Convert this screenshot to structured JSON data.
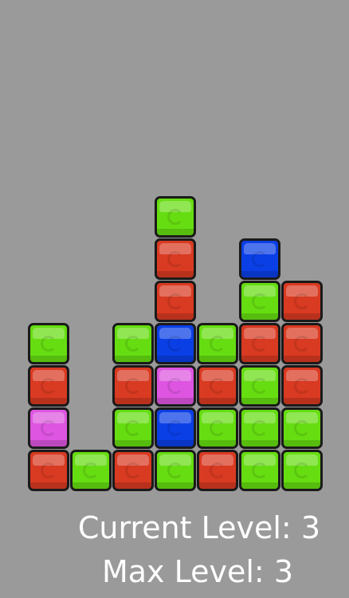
{
  "colors": {
    "background": "#9a9a9a",
    "green": "#66dd11",
    "red": "#d93a22",
    "blue": "#0b3fe6",
    "purple": "#dd55e0",
    "text": "#ffffff"
  },
  "board": {
    "columns": [
      [
        "red",
        "purple",
        "red",
        "green"
      ],
      [
        "green"
      ],
      [
        "red",
        "green",
        "red",
        "green"
      ],
      [
        "green",
        "blue",
        "purple",
        "blue",
        "red",
        "red",
        "green"
      ],
      [
        "red",
        "green",
        "red",
        "green"
      ],
      [
        "green",
        "green",
        "green",
        "red",
        "green",
        "blue"
      ],
      [
        "green",
        "green",
        "red",
        "red",
        "red"
      ]
    ]
  },
  "hud": {
    "current_level": "Current Level: 3",
    "max_level": "Max Level: 3"
  }
}
